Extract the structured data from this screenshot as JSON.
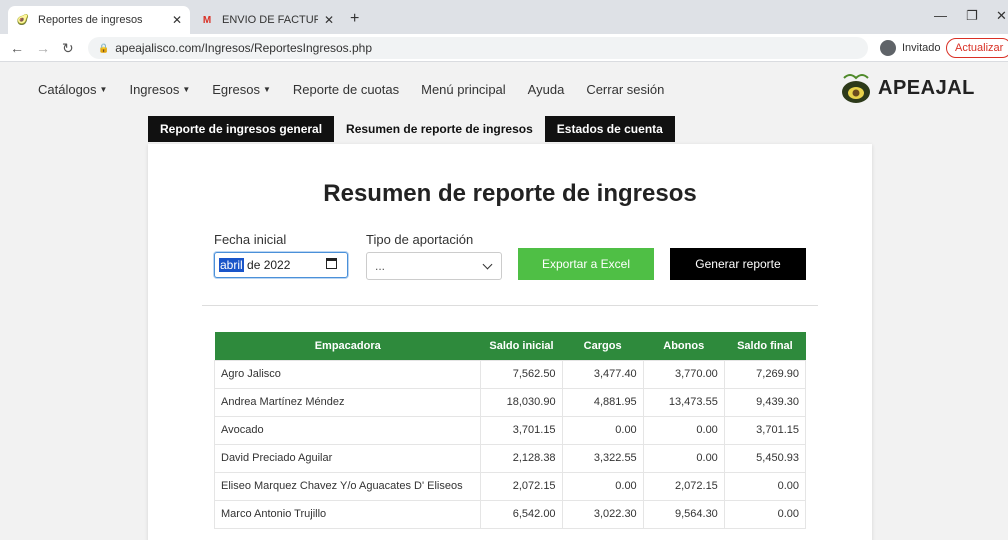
{
  "browser": {
    "tabs": [
      {
        "title": "Reportes de ingresos",
        "active": true,
        "favicon": "avocado-icon"
      },
      {
        "title": "ENVIO DE FACTURA DE ACOPIO",
        "active": false,
        "favicon": "gmail-icon"
      }
    ],
    "new_tab": "+",
    "url": "apeajalisco.com/Ingresos/ReportesIngresos.php",
    "profile_label": "Invitado",
    "update_label": "Actualizar"
  },
  "nav": {
    "items": [
      {
        "label": "Catálogos",
        "dropdown": true
      },
      {
        "label": "Ingresos",
        "dropdown": true
      },
      {
        "label": "Egresos",
        "dropdown": true
      },
      {
        "label": "Reporte de cuotas",
        "dropdown": false
      },
      {
        "label": "Menú principal",
        "dropdown": false
      },
      {
        "label": "Ayuda",
        "dropdown": false
      },
      {
        "label": "Cerrar sesión",
        "dropdown": false
      }
    ],
    "logo_text": "APEAJAL"
  },
  "page_tabs": [
    {
      "label": "Reporte de ingresos general",
      "active": false
    },
    {
      "label": "Resumen de reporte de ingresos",
      "active": true
    },
    {
      "label": "Estados de cuenta",
      "active": false
    }
  ],
  "title": "Resumen de reporte de ingresos",
  "form": {
    "fecha_label": "Fecha inicial",
    "fecha_month": "abril",
    "fecha_rest": " de 2022",
    "tipo_label": "Tipo de aportación",
    "tipo_value": "...",
    "export_label": "Exportar a Excel",
    "generate_label": "Generar reporte"
  },
  "table": {
    "headers": [
      "Empacadora",
      "Saldo inicial",
      "Cargos",
      "Abonos",
      "Saldo final"
    ],
    "rows": [
      [
        "Agro Jalisco",
        "7,562.50",
        "3,477.40",
        "3,770.00",
        "7,269.90"
      ],
      [
        "Andrea Martínez Méndez",
        "18,030.90",
        "4,881.95",
        "13,473.55",
        "9,439.30"
      ],
      [
        "Avocado",
        "3,701.15",
        "0.00",
        "0.00",
        "3,701.15"
      ],
      [
        "David Preciado Aguilar",
        "2,128.38",
        "3,322.55",
        "0.00",
        "5,450.93"
      ],
      [
        "Eliseo Marquez Chavez Y/o Aguacates D' Eliseos",
        "2,072.15",
        "0.00",
        "2,072.15",
        "0.00"
      ],
      [
        "Marco Antonio Trujillo",
        "6,542.00",
        "3,022.30",
        "9,564.30",
        "0.00"
      ]
    ]
  },
  "colors": {
    "header_green": "#2e8a3c",
    "excel_green": "#4fbf45",
    "update_red": "#d93025"
  }
}
